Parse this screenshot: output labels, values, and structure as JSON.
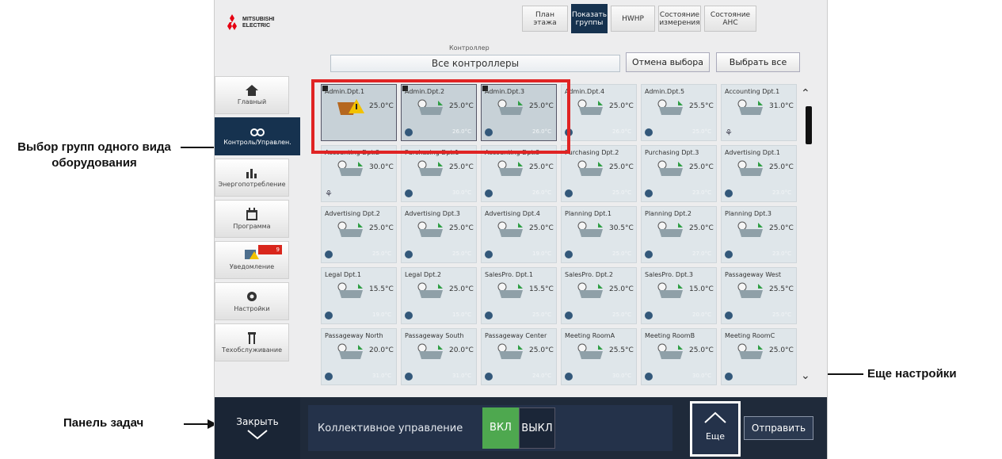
{
  "annotations": {
    "group_select": "Выбор групп одного вида оборудования",
    "taskbar": "Панель задач",
    "more_settings": "Еще настройки"
  },
  "logo": {
    "line1": "MITSUBISHI",
    "line2": "ELECTRIC"
  },
  "top_tabs": [
    {
      "label": "План этажа",
      "active": false
    },
    {
      "label": "Показать группы",
      "active": true
    },
    {
      "label": "HWHP",
      "active": false
    },
    {
      "label": "Состояние измерения",
      "active": false
    },
    {
      "label": "Состояние AHC",
      "active": false
    }
  ],
  "controller": {
    "label": "Контроллер",
    "value": "Все контроллеры",
    "deselect_label": "Отмена выбора",
    "select_all_label": "Выбрать все"
  },
  "nav": [
    {
      "label": "Главный",
      "icon": "home-icon",
      "active": false
    },
    {
      "label": "Контроль/Управлен.",
      "icon": "binoculars-icon",
      "active": true
    },
    {
      "label": "Энергопотребление",
      "icon": "bar-chart-icon",
      "active": false
    },
    {
      "label": "Программа",
      "icon": "calendar-icon",
      "active": false
    },
    {
      "label": "Уведомление",
      "icon": "notification-icon",
      "active": false,
      "badge": "9"
    },
    {
      "label": "Настройки",
      "icon": "gear-icon",
      "active": false
    },
    {
      "label": "Техобслуживание",
      "icon": "tools-icon",
      "active": false
    }
  ],
  "groups": [
    [
      {
        "name": "Admin.Dpt.1",
        "temp": "25.0°C",
        "selected": true,
        "warn": true,
        "foot": ""
      },
      {
        "name": "Admin.Dpt.2",
        "temp": "25.0°C",
        "selected": true,
        "foot": "26.0°C"
      },
      {
        "name": "Admin.Dpt.3",
        "temp": "25.0°C",
        "selected": true,
        "foot": "26.0°C"
      },
      {
        "name": "Admin.Dpt.4",
        "temp": "25.0°C",
        "selected": false,
        "foot": "26.0°C"
      },
      {
        "name": "Admin.Dpt.5",
        "temp": "25.5°C",
        "selected": false,
        "foot": "25.0°C"
      },
      {
        "name": "Accounting Dpt.1",
        "temp": "31.0°C",
        "selected": false,
        "fan": true,
        "foot": ""
      }
    ],
    [
      {
        "name": "Accounting Dpt.2",
        "temp": "30.0°C",
        "selected": false,
        "fan": true,
        "foot": ""
      },
      {
        "name": "Purchasing Dpt.1",
        "temp": "25.0°C",
        "selected": false,
        "foot": "30.0°C"
      },
      {
        "name": "Accounting Dpt.3",
        "temp": "25.0°C",
        "selected": false,
        "foot": "26.0°C"
      },
      {
        "name": "Purchasing Dpt.2",
        "temp": "25.0°C",
        "selected": false,
        "foot": "25.0°C"
      },
      {
        "name": "Purchasing Dpt.3",
        "temp": "25.0°C",
        "selected": false,
        "foot": "23.0°C"
      },
      {
        "name": "Advertising Dpt.1",
        "temp": "25.0°C",
        "selected": false,
        "foot": "23.0°C"
      }
    ],
    [
      {
        "name": "Advertising Dpt.2",
        "temp": "25.0°C",
        "selected": false,
        "foot": "25.0°C"
      },
      {
        "name": "Advertising Dpt.3",
        "temp": "25.0°C",
        "selected": false,
        "foot": "25.0°C"
      },
      {
        "name": "Advertising Dpt.4",
        "temp": "25.0°C",
        "selected": false,
        "foot": "19.0°C"
      },
      {
        "name": "Planning Dpt.1",
        "temp": "30.5°C",
        "selected": false,
        "foot": "25.0°C"
      },
      {
        "name": "Planning Dpt.2",
        "temp": "25.0°C",
        "selected": false,
        "foot": "27.0°C"
      },
      {
        "name": "Planning Dpt.3",
        "temp": "25.0°C",
        "selected": false,
        "foot": "23.0°C"
      }
    ],
    [
      {
        "name": "Legal Dpt.1",
        "temp": "15.5°C",
        "selected": false,
        "foot": "19.0°C"
      },
      {
        "name": "Legal Dpt.2",
        "temp": "25.0°C",
        "selected": false,
        "foot": "15.0°C"
      },
      {
        "name": "SalesPro. Dpt.1",
        "temp": "15.5°C",
        "selected": false,
        "foot": "25.0°C"
      },
      {
        "name": "SalesPro. Dpt.2",
        "temp": "25.0°C",
        "selected": false,
        "foot": "25.0°C"
      },
      {
        "name": "SalesPro. Dpt.3",
        "temp": "15.0°C",
        "selected": false,
        "foot": "20.0°C"
      },
      {
        "name": "Passageway West",
        "temp": "25.5°C",
        "selected": false,
        "foot": "25.0°C"
      }
    ],
    [
      {
        "name": "Passageway North",
        "temp": "20.0°C",
        "selected": false,
        "foot": "31.0°C"
      },
      {
        "name": "Passageway South",
        "temp": "20.0°C",
        "selected": false,
        "foot": "31.0°C"
      },
      {
        "name": "Passageway Center",
        "temp": "25.0°C",
        "selected": false,
        "foot": "24.0°C"
      },
      {
        "name": "Meeting RoomA",
        "temp": "25.5°C",
        "selected": false,
        "foot": "30.0°C"
      },
      {
        "name": "Meeting RoomB",
        "temp": "25.0°C",
        "selected": false,
        "foot": "30.0°C"
      },
      {
        "name": "Meeting RoomC",
        "temp": "25.0°C",
        "selected": false,
        "foot": ""
      }
    ]
  ],
  "bottom": {
    "close_label": "Закрыть",
    "collective_label": "Коллективное управление",
    "on_label": "ВКЛ",
    "off_label": "ВЫКЛ",
    "more_label": "Еще",
    "send_label": "Отправить"
  },
  "colors": {
    "nav_active": "#16324f",
    "on_green": "#4ea84f",
    "highlight_red": "#e02424",
    "bottom_bar": "#1f2a3a"
  }
}
